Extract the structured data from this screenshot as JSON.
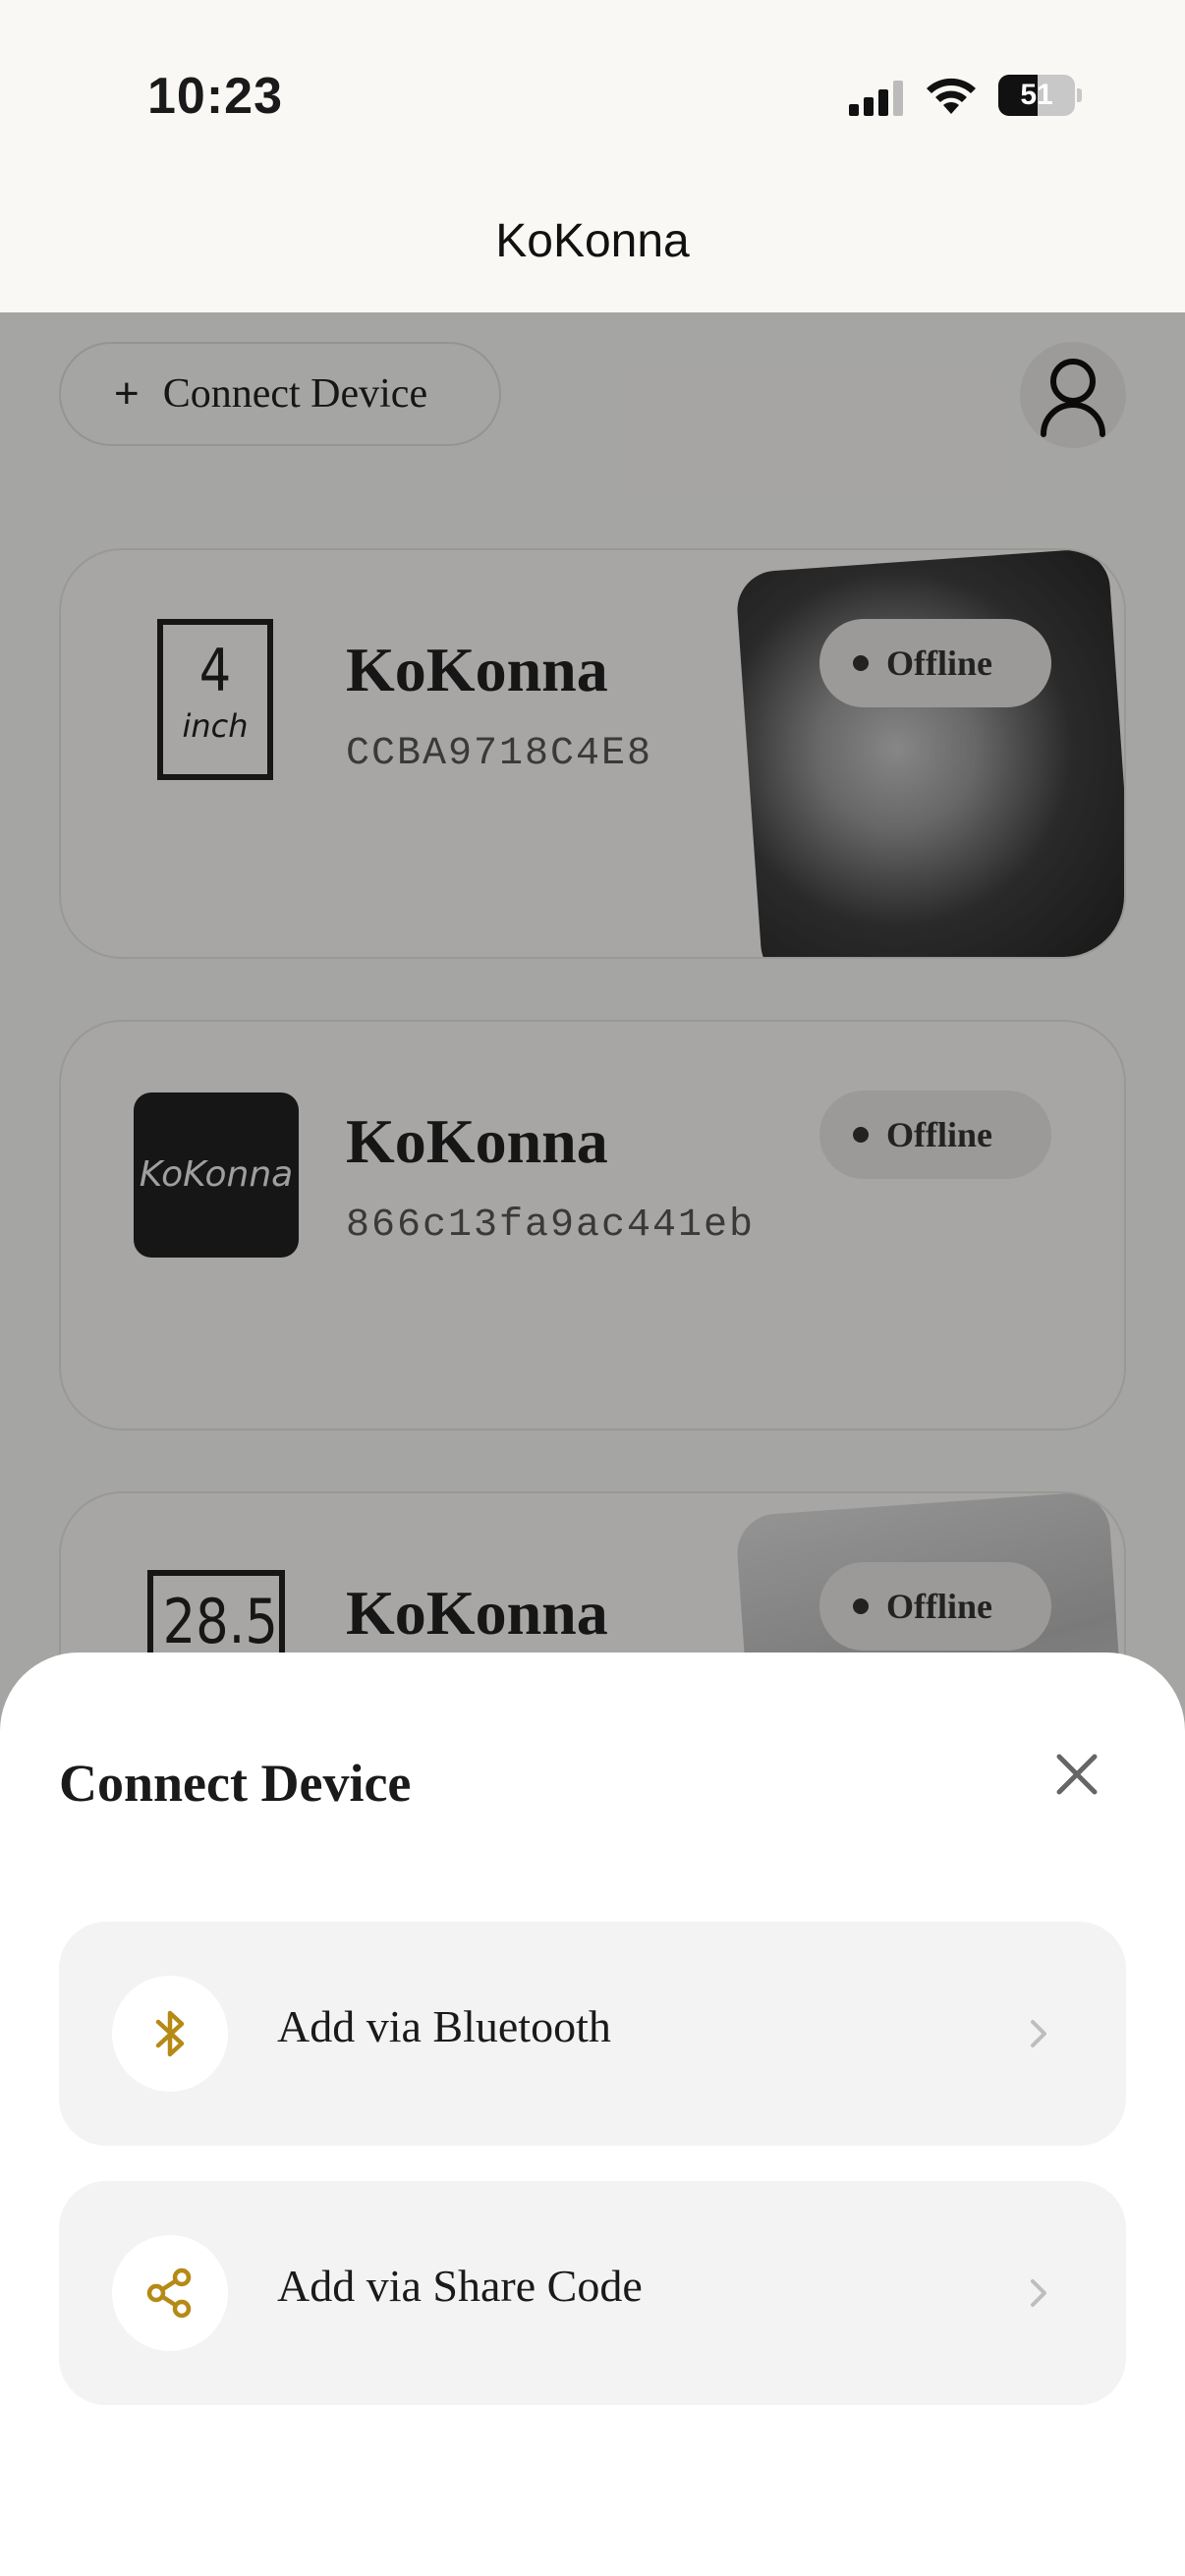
{
  "status_bar": {
    "time": "10:23",
    "battery_level": "51",
    "battery_percent": 51
  },
  "nav": {
    "title": "KoKonna"
  },
  "main": {
    "connect_button_label": "Connect Device",
    "profile_icon": "user-icon",
    "devices": [
      {
        "name": "KoKonna",
        "serial": "CCBA9718C4E8",
        "status": "Offline",
        "size_value": "4",
        "size_unit": "inch"
      },
      {
        "name": "KoKonna",
        "serial": "866c13fa9ac441eb",
        "status": "Offline",
        "logo_text": "KoKonna"
      },
      {
        "name": "KoKonna",
        "status": "Offline",
        "size_value": "28.5"
      }
    ]
  },
  "sheet": {
    "title": "Connect Device",
    "close_icon": "close-icon",
    "options": [
      {
        "label": "Add via Bluetooth",
        "icon": "bluetooth-icon"
      },
      {
        "label": "Add via Share Code",
        "icon": "share-icon"
      }
    ]
  },
  "colors": {
    "accent": "#b58a15",
    "sheet_background": "#ffffff",
    "option_background": "#f3f3f3",
    "overlay": "rgba(0,0,0,0.33)"
  }
}
